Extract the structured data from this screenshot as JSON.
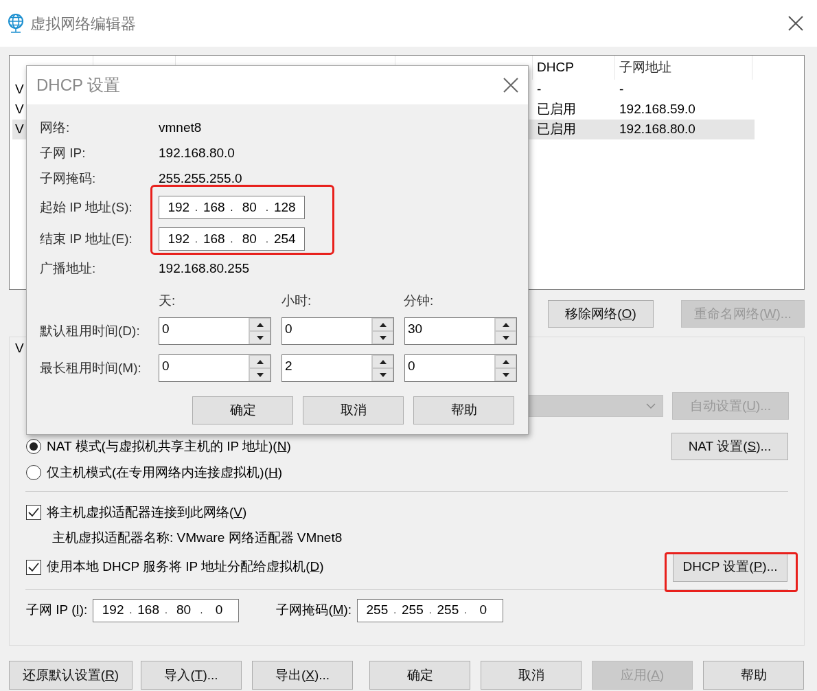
{
  "window": {
    "title": "虚拟网络编辑器"
  },
  "table": {
    "headers": {
      "dhcp": "DHCP",
      "subnet": "子网地址"
    },
    "rows": [
      {
        "name": "V",
        "dhcp": "-",
        "subnet": "-",
        "selected": false
      },
      {
        "name": "V",
        "dhcp": "已启用",
        "subnet": "192.168.59.0",
        "selected": false
      },
      {
        "name": "V",
        "dhcp": "已启用",
        "subnet": "192.168.80.0",
        "selected": true
      }
    ]
  },
  "table_buttons": [
    {
      "label": [
        "移除网络(",
        "O",
        ")"
      ],
      "disabled": false
    },
    {
      "label": [
        "重命名网络(",
        "W",
        ")..."
      ],
      "disabled": true
    }
  ],
  "vmnet_info": {
    "legend": "V",
    "bridge_adapter": {
      "disabled": true
    },
    "auto_button": {
      "label": [
        "自动设置(",
        "U",
        ")..."
      ],
      "disabled": true
    },
    "modes": [
      {
        "label": [
          "NAT 模式(与虚拟机共享主机的 IP 地址)(",
          "N",
          ")"
        ],
        "selected": true
      },
      {
        "label": [
          "仅主机模式(在专用网络内连接虚拟机)(",
          "H",
          ")"
        ],
        "selected": false
      }
    ],
    "nat_button": {
      "label": [
        "NAT 设置(",
        "S",
        ")..."
      ],
      "disabled": false
    },
    "connect_adapter": {
      "label": [
        "将主机虚拟适配器连接到此网络(",
        "V",
        ")"
      ],
      "checked": true
    },
    "adapter_name": "主机虚拟适配器名称: VMware 网络适配器 VMnet8",
    "use_dhcp": {
      "label": [
        "使用本地 DHCP 服务将 IP 地址分配给虚拟机(",
        "D",
        ")"
      ],
      "checked": true
    },
    "dhcp_button": {
      "label": [
        "DHCP 设置(",
        "P",
        ")..."
      ],
      "disabled": false,
      "highlighted": true
    },
    "subnet_ip": {
      "label": [
        "子网 IP (",
        "I",
        "):"
      ],
      "octets": [
        "192",
        "168",
        "80",
        "0"
      ],
      "dot": "."
    },
    "subnet_mask": {
      "label": [
        "子网掩码(",
        "M",
        "):"
      ],
      "octets": [
        "255",
        "255",
        "255",
        "0"
      ],
      "dot": "."
    }
  },
  "footer_buttons": [
    {
      "label": [
        "还原默认设置(",
        "R",
        ")"
      ],
      "disabled": false
    },
    {
      "label": [
        "导入(",
        "T",
        ")..."
      ],
      "disabled": false
    },
    {
      "label": [
        "导出(",
        "X",
        ")..."
      ],
      "disabled": false
    },
    {
      "label": "确定",
      "disabled": false
    },
    {
      "label": "取消",
      "disabled": false
    },
    {
      "label": [
        "应用(",
        "A",
        ")"
      ],
      "disabled": true
    },
    {
      "label": "帮助",
      "disabled": false
    }
  ],
  "dhcp_dialog": {
    "title": "DHCP 设置",
    "info": [
      {
        "label": "网络:",
        "value": "vmnet8"
      },
      {
        "label": "子网 IP:",
        "value": "192.168.80.0"
      },
      {
        "label": "子网掩码:",
        "value": "255.255.255.0"
      }
    ],
    "range": [
      {
        "label": "起始 IP 地址(S):",
        "octets": [
          "192",
          "168",
          "80",
          "128"
        ],
        "dot": "."
      },
      {
        "label": "结束 IP 地址(E):",
        "octets": [
          "192",
          "168",
          "80",
          "254"
        ],
        "dot": "."
      }
    ],
    "range_highlighted": true,
    "broadcast": {
      "label": "广播地址:",
      "value": "192.168.80.255"
    },
    "lease_units": [
      "天:",
      "小时:",
      "分钟:"
    ],
    "leases": [
      {
        "label": "默认租用时间(D):",
        "values": [
          "0",
          "0",
          "30"
        ]
      },
      {
        "label": "最长租用时间(M):",
        "values": [
          "0",
          "2",
          "0"
        ]
      }
    ],
    "buttons": [
      {
        "label": "确定"
      },
      {
        "label": "取消"
      },
      {
        "label": "帮助"
      }
    ]
  }
}
